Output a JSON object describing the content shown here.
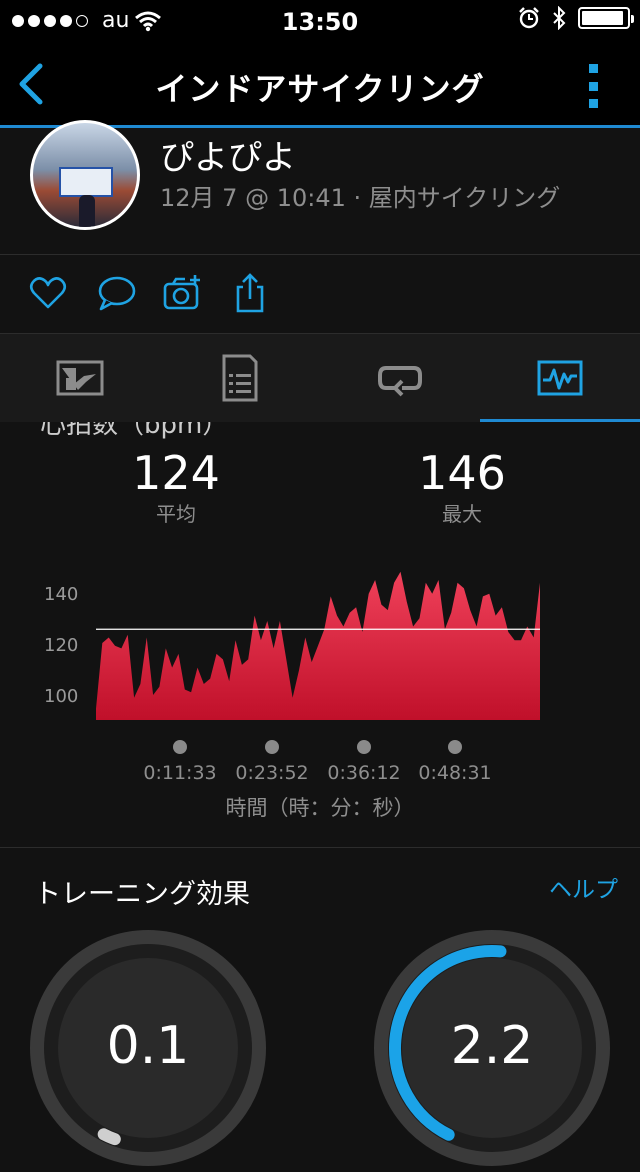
{
  "status_bar": {
    "carrier": "au",
    "time": "13:50"
  },
  "nav": {
    "title": "インドアサイクリング",
    "back_icon": "chevron-left-icon",
    "more_icon": "more-vertical-icon",
    "accent": "#1f8ad2"
  },
  "profile": {
    "name": "ぴよぴよ",
    "meta": "12月 7 @ 10:41 · 屋内サイクリング"
  },
  "actions": [
    "heart-icon",
    "comment-icon",
    "camera-add-icon",
    "share-icon"
  ],
  "tabs": [
    {
      "icon": "overview-icon",
      "active": false
    },
    {
      "icon": "details-icon",
      "active": false
    },
    {
      "icon": "laps-icon",
      "active": false
    },
    {
      "icon": "charts-icon",
      "active": true
    }
  ],
  "heart_rate": {
    "title": "心拍数（bpm）",
    "avg_value": "124",
    "avg_label": "平均",
    "max_value": "146",
    "max_label": "最大"
  },
  "chart_data": {
    "type": "area",
    "ylabel": "",
    "xlabel": "時間（時：分：秒）",
    "yticks": [
      "140",
      "120",
      "100"
    ],
    "ylim": [
      94,
      148
    ],
    "xticks": [
      "0:11:33",
      "0:23:52",
      "0:36:12",
      "0:48:31"
    ],
    "average_line": 124,
    "color": "#e2273e",
    "values": [
      95,
      119,
      121,
      118,
      117,
      122,
      99,
      104,
      121,
      100,
      103,
      117,
      110,
      115,
      102,
      101,
      110,
      104,
      106,
      115,
      113,
      105,
      120,
      111,
      113,
      129,
      120,
      127,
      117,
      127,
      113,
      99,
      109,
      121,
      112,
      118,
      124,
      136,
      129,
      125,
      130,
      132,
      123,
      137,
      142,
      133,
      131,
      141,
      145,
      134,
      125,
      128,
      141,
      137,
      142,
      124,
      130,
      141,
      139,
      131,
      125,
      136,
      137,
      129,
      132,
      123,
      120,
      120,
      125,
      121,
      141
    ]
  },
  "training": {
    "title": "トレーニング効果",
    "help": "ヘルプ",
    "aerobic": "0.1",
    "anaerobic": "2.2",
    "accent": "#1ba3e8"
  }
}
